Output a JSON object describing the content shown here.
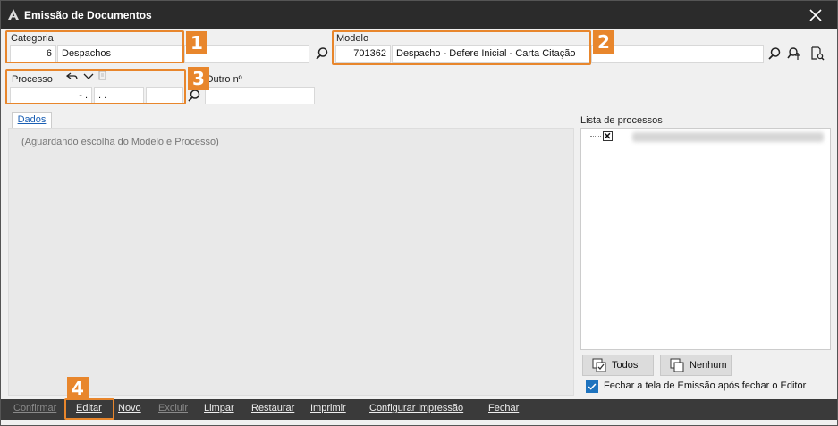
{
  "window": {
    "title": "Emissão de Documentos"
  },
  "categoria": {
    "label": "Categoria",
    "code": "6",
    "name": "Despachos",
    "extra": ""
  },
  "modelo": {
    "label": "Modelo",
    "code": "701362",
    "name": "Despacho - Defere Inicial - Carta Citação",
    "extra": ""
  },
  "processo": {
    "label": "Processo",
    "part1": "- .",
    "part2": ". .",
    "part3": ""
  },
  "outro": {
    "label": "Outro nº",
    "value": ""
  },
  "tabs": {
    "dados": "Dados"
  },
  "dados": {
    "hint": "(Aguardando escolha do Modelo e Processo)"
  },
  "lista": {
    "label": "Lista de processos"
  },
  "buttons": {
    "todos": "Todos",
    "nenhum": "Nenhum"
  },
  "options": {
    "fechar_tela": "Fechar a tela de Emissão após fechar o Editor",
    "fechar_tela_checked": true
  },
  "toolbar": {
    "confirmar": "Confirmar",
    "editar": "Editar",
    "novo": "Novo",
    "excluir": "Excluir",
    "limpar": "Limpar",
    "restaurar": "Restaurar",
    "imprimir": "Imprimir",
    "configurar": "Configurar impressão",
    "fechar": "Fechar"
  },
  "annotations": {
    "b1": "1",
    "b2": "2",
    "b3": "3",
    "b4": "4"
  },
  "colors": {
    "highlight": "#e8862c",
    "titlebar": "#2b2b2b",
    "accent": "#1e73be"
  }
}
